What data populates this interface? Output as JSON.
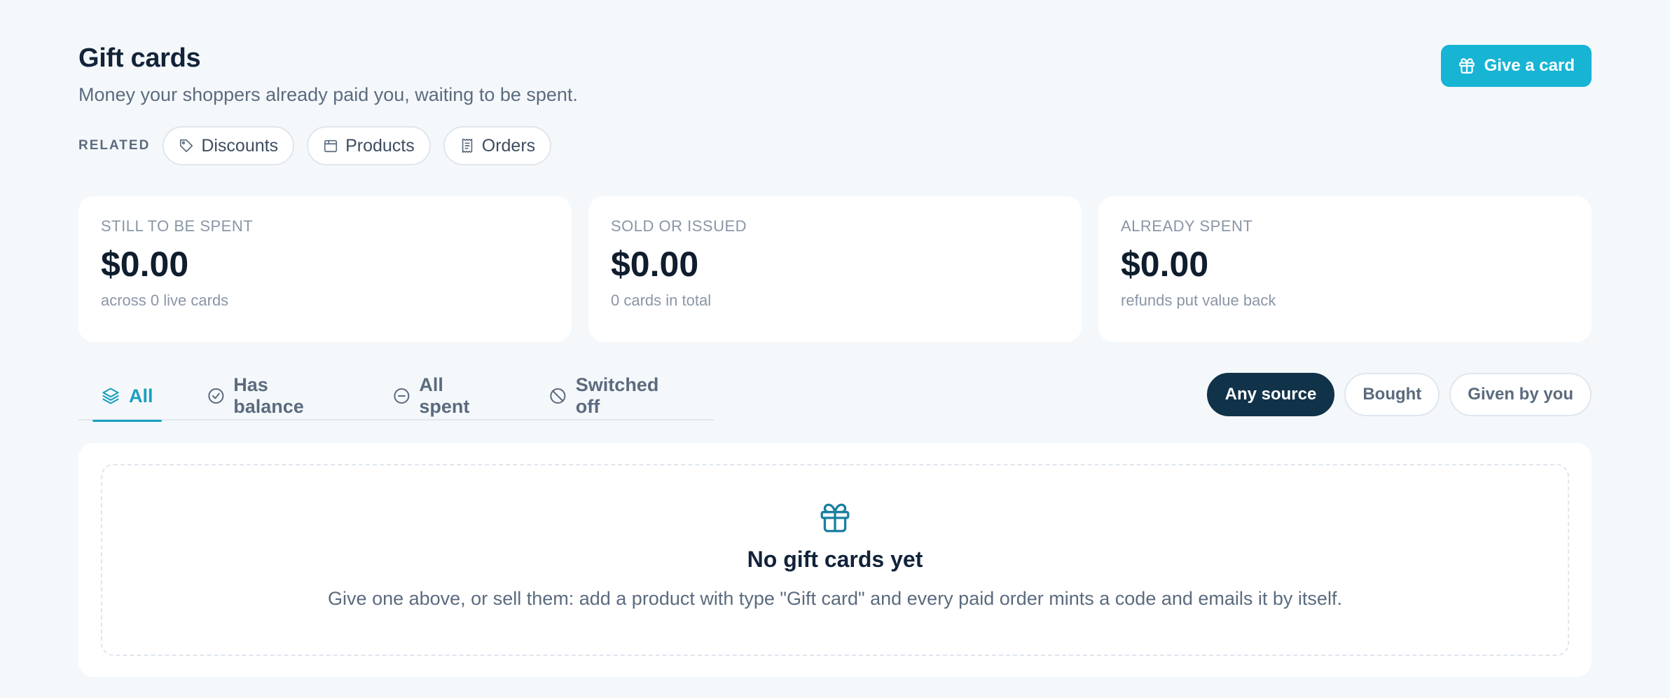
{
  "header": {
    "title": "Gift cards",
    "subtitle": "Money your shoppers already paid you, waiting to be spent.",
    "give_button_label": "Give a card",
    "give_button_icon": "gift-icon"
  },
  "related": {
    "label": "RELATED",
    "links": [
      {
        "label": "Discounts",
        "icon": "tag-icon"
      },
      {
        "label": "Products",
        "icon": "box-icon"
      },
      {
        "label": "Orders",
        "icon": "receipt-icon"
      }
    ]
  },
  "stats": [
    {
      "label": "STILL TO BE SPENT",
      "value": "$0.00",
      "note": "across 0 live cards"
    },
    {
      "label": "SOLD OR ISSUED",
      "value": "$0.00",
      "note": "0 cards in total"
    },
    {
      "label": "ALREADY SPENT",
      "value": "$0.00",
      "note": "refunds put value back"
    }
  ],
  "tabs": [
    {
      "label": "All",
      "icon": "layers-icon",
      "active": true
    },
    {
      "label": "Has balance",
      "icon": "check-circle-icon",
      "active": false
    },
    {
      "label": "All spent",
      "icon": "minus-circle-icon",
      "active": false
    },
    {
      "label": "Switched off",
      "icon": "ban-icon",
      "active": false
    }
  ],
  "source_filters": [
    {
      "label": "Any source",
      "active": true
    },
    {
      "label": "Bought",
      "active": false
    },
    {
      "label": "Given by you",
      "active": false
    }
  ],
  "empty_state": {
    "icon": "gift-icon",
    "title": "No gift cards yet",
    "text": "Give one above, or sell them: add a product with type \"Gift card\" and every paid order mints a code and emails it by itself."
  },
  "colors": {
    "accent": "#17b4d4",
    "active_tab": "#1a9fc0",
    "active_filter_bg": "#11334a",
    "background": "#f5f8fb"
  }
}
